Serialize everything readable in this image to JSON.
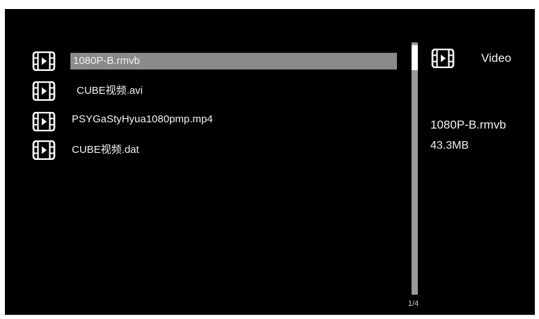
{
  "file_list": {
    "items": [
      {
        "label": "1080P-B.rmvb",
        "icon": "video-file-icon",
        "selected": true
      },
      {
        "label": "CUBE视频.avi",
        "icon": "video-file-icon",
        "selected": false
      },
      {
        "label": "PSYGaStyHyua1080pmp.mp4",
        "icon": "video-file-icon",
        "selected": false
      },
      {
        "label": "CUBE视频.dat",
        "icon": "video-file-icon",
        "selected": false
      }
    ]
  },
  "pagination": {
    "text": "1/4"
  },
  "info_panel": {
    "type_label": "Video",
    "icon": "video-file-icon",
    "file_name": "1080P-B.rmvb",
    "file_size": "43.3MB"
  },
  "colors": {
    "background": "#000000",
    "highlight": "#8a8a8a",
    "text": "#f2f2f2",
    "scroll_track": "#9a9a9a",
    "scroll_thumb": "#ffffff"
  }
}
